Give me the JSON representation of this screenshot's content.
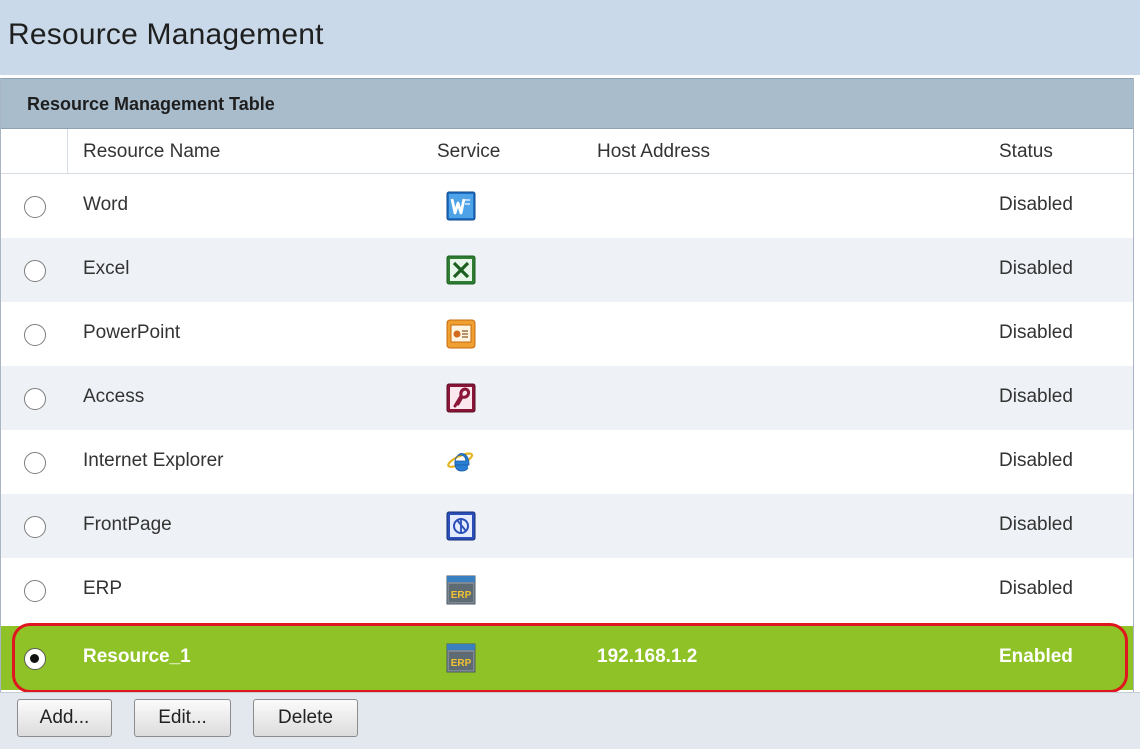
{
  "page": {
    "title": "Resource Management"
  },
  "table": {
    "title": "Resource Management Table",
    "columns": {
      "resource_name": "Resource Name",
      "service": "Service",
      "host_address": "Host Address",
      "status": "Status"
    },
    "rows": [
      {
        "name": "Word",
        "service_icon": "word-icon",
        "host": "",
        "status": "Disabled",
        "selected": false
      },
      {
        "name": "Excel",
        "service_icon": "excel-icon",
        "host": "",
        "status": "Disabled",
        "selected": false
      },
      {
        "name": "PowerPoint",
        "service_icon": "powerpoint-icon",
        "host": "",
        "status": "Disabled",
        "selected": false
      },
      {
        "name": "Access",
        "service_icon": "access-icon",
        "host": "",
        "status": "Disabled",
        "selected": false
      },
      {
        "name": "Internet Explorer",
        "service_icon": "internet-explorer-icon",
        "host": "",
        "status": "Disabled",
        "selected": false
      },
      {
        "name": "FrontPage",
        "service_icon": "frontpage-icon",
        "host": "",
        "status": "Disabled",
        "selected": false
      },
      {
        "name": "ERP",
        "service_icon": "erp-icon",
        "host": "",
        "status": "Disabled",
        "selected": false
      },
      {
        "name": "Resource_1",
        "service_icon": "erp-icon",
        "host": "192.168.1.2",
        "status": "Enabled",
        "selected": true
      }
    ]
  },
  "buttons": {
    "add": "Add...",
    "edit": "Edit...",
    "delete": "Delete"
  },
  "icon_text": {
    "erp": "ERP"
  },
  "colors": {
    "header_bg": "#c9d9e9",
    "table_title_bg": "#a9bccb",
    "selected_row_bg": "#8ec226",
    "highlight_outline": "#e0161f"
  }
}
